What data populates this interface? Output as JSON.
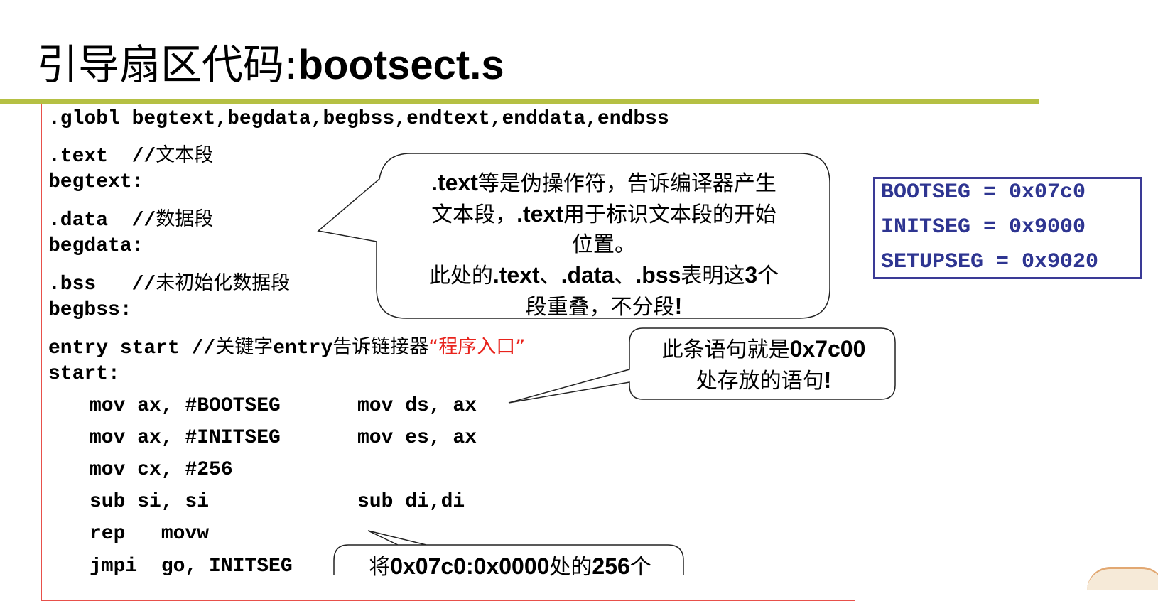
{
  "title": {
    "cn": "引导扇区代码:",
    "en": "bootsect.s"
  },
  "code": {
    "l1": ".globl begtext,begdata,begbss,endtext,enddata,endbss",
    "l2_code": ".text  //",
    "l2_cmt": "文本段",
    "l3": "begtext:",
    "l4_code": ".data  //",
    "l4_cmt": "数据段",
    "l5": "begdata:",
    "l6_code": ".bss   //",
    "l6_cmt": "未初始化数据段",
    "l7": "begbss:",
    "l8_code": "entry start //",
    "l8_cmt1": "关键字",
    "l8_kw": "entry",
    "l8_cmt2": "告诉链接器",
    "l8_red": "“程序入口”",
    "l9": "start:",
    "l10a": "mov ax, #BOOTSEG",
    "l10b": "mov ds, ax",
    "l11a": "mov ax, #INITSEG",
    "l11b": "mov es, ax",
    "l12a": "mov cx, #256",
    "l13a": "sub si, si",
    "l13b": "sub di,di",
    "l14a": "rep   movw",
    "l15a": "jmpi  go, INITSEG"
  },
  "callouts": {
    "c1": {
      "b1": ".text",
      "t1": "等是伪操作符，告诉编译器产生",
      "t2": "文本段，",
      "b2": ".text",
      "t3": "用于标识文本段的开始",
      "t4": "位置。",
      "t5": "此处的",
      "b3": ".text",
      "t6": "、",
      "b4": ".data",
      "t7": "、",
      "b5": ".bss",
      "t8": "表明这",
      "b6": "3",
      "t9": "个",
      "t10": "段重叠，不分段",
      "b7": "!"
    },
    "c2": {
      "t1": "此条语句就是",
      "b1": "0x7c00",
      "t2": "处存放的语句",
      "b2": "!"
    },
    "c3": {
      "t1": "将",
      "b1": "0x07c0:0x0000",
      "t2": "处的",
      "b2": "256",
      "t3": "个"
    }
  },
  "segments": [
    "BOOTSEG = 0x07c0",
    "INITSEG = 0x9000",
    "SETUPSEG = 0x9020"
  ],
  "colors": {
    "rule": "#b5c043",
    "code_border": "#e8504a",
    "seg": "#2e3591",
    "red": "#e8231c"
  }
}
